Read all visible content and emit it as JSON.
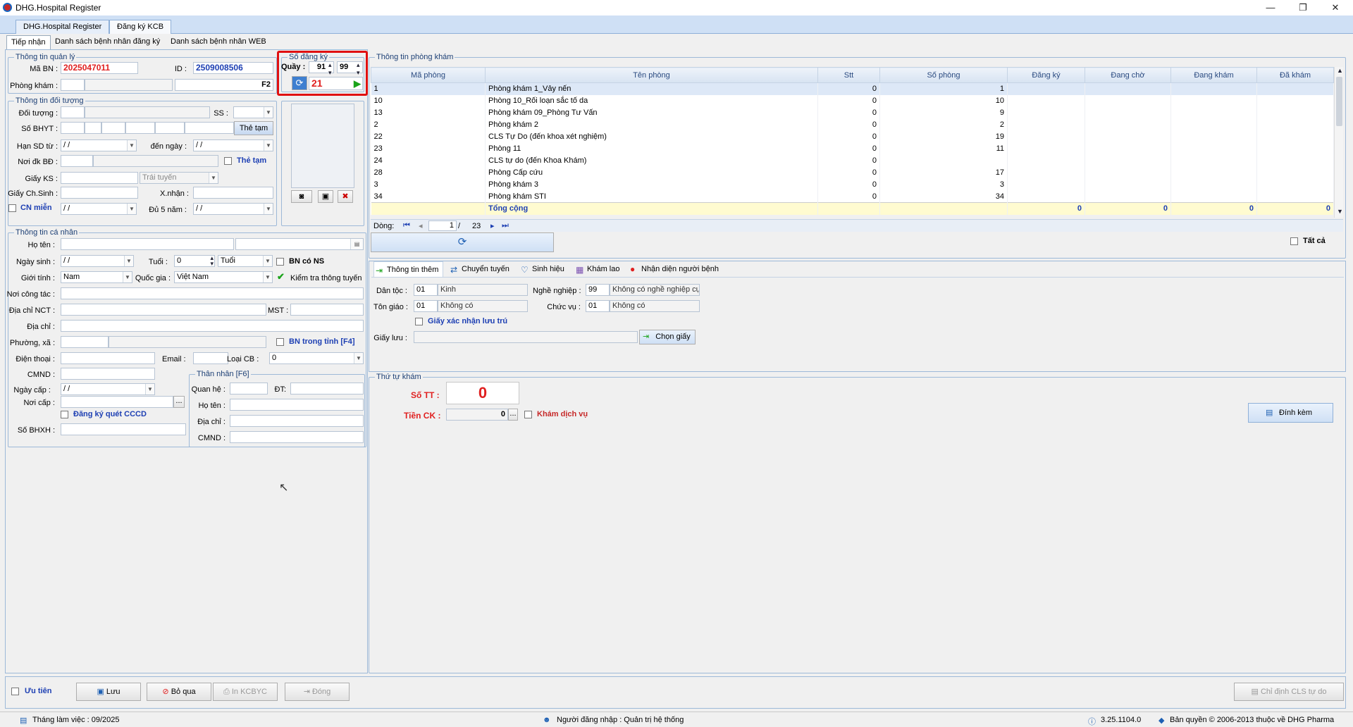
{
  "window": {
    "title": "DHG.Hospital Register",
    "controls": [
      "—",
      "❐",
      "✕"
    ]
  },
  "doc_tabs": [
    "DHG.Hospital Register",
    "Đăng ký KCB"
  ],
  "main_tabs": [
    "Tiếp nhận",
    "Danh sách bệnh nhân đăng ký",
    "Danh sách bệnh nhân WEB"
  ],
  "quanly": {
    "legend": "Thông tin quản lý",
    "mabn_label": "Mã BN :",
    "mabn": "2025047011",
    "id_label": "ID :",
    "id": "2509008506",
    "phongkham_label": "Phòng khám :",
    "f2": "F2"
  },
  "sodangky": {
    "legend": "Số đăng ký",
    "quay_label": "Quầy :",
    "quay1": "91",
    "quay2": "99",
    "so": "21"
  },
  "doituong": {
    "legend": "Thông tin đối tượng",
    "doituong_label": "Đối tượng :",
    "ss_label": "SS :",
    "sobhyt_label": "Số BHYT :",
    "thetam_btn": "Thẻ tạm",
    "hansd_label": "Hạn SD từ :",
    "denngay_label": "đến ngày :",
    "date_empty": " /    /",
    "noidk_label": "Nơi đk BĐ :",
    "thetam_chk": "Thẻ tạm",
    "giayks_label": "Giấy KS :",
    "traituyen": "Trái tuyến",
    "giaychsinh_label": "Giấy Ch.Sinh :",
    "xnhan_label": "X.nhận :",
    "cnmien_label": "CN miễn",
    "du5nam_label": "Đủ 5 năm :"
  },
  "canhan": {
    "legend": "Thông tin cá nhân",
    "hoten_label": "Họ tên :",
    "ngaysinh_label": "Ngày sinh :",
    "tuoi_label": "Tuổi :",
    "tuoi": "0",
    "tuoi_unit": "Tuổi",
    "bncons": "BN có NS",
    "gioitinh_label": "Giới tính :",
    "gioitinh": "Nam",
    "quocgia_label": "Quốc gia :",
    "quocgia": "Việt Nam",
    "kiemtra": "Kiểm tra thông tuyến",
    "noicongtac_label": "Nơi công tác :",
    "diachinct_label": "Địa chỉ NCT :",
    "mst_label": "MST :",
    "diachi_label": "Địa chỉ :",
    "phuongxa_label": "Phường, xã :",
    "bntrongtinh": "BN trong tỉnh [F4]",
    "dienthoai_label": "Điện thoại :",
    "email_label": "Email :",
    "loaicb_label": "Loại CB :",
    "loaicb": "0",
    "cmnd_label": "CMND :",
    "ngaycap_label": "Ngày cấp :",
    "noicap_label": "Nơi cấp :",
    "dots": "...",
    "dangkycccd": "Đăng ký quét CCCD",
    "sobhxh_label": "Số BHXH :",
    "thannhan": {
      "legend": "Thân nhân [F6]",
      "quanhe_label": "Quan hệ :",
      "dt_label": "ĐT:",
      "hoten_label": "Họ tên :",
      "diachi_label": "Địa chỉ :",
      "cmnd_label": "CMND :"
    }
  },
  "phongkham": {
    "legend": "Thông tin phòng khám",
    "columns": [
      "Mã phòng",
      "Tên phòng",
      "Stt",
      "Số phòng",
      "Đăng ký",
      "Đang chờ",
      "Đang khám",
      "Đã khám"
    ],
    "rows": [
      [
        "1",
        "Phòng khám 1_Vảy nến",
        "0",
        "1",
        "",
        "",
        "",
        ""
      ],
      [
        "10",
        "Phòng 10_Rối loạn sắc tố da",
        "0",
        "10",
        "",
        "",
        "",
        ""
      ],
      [
        "13",
        "Phòng khám 09_Phòng Tư Vấn",
        "0",
        "9",
        "",
        "",
        "",
        ""
      ],
      [
        "2",
        "Phòng khám 2",
        "0",
        "2",
        "",
        "",
        "",
        ""
      ],
      [
        "22",
        "CLS Tự Do (đến khoa xét nghiệm)",
        "0",
        "19",
        "",
        "",
        "",
        ""
      ],
      [
        "23",
        "Phòng 11",
        "0",
        "11",
        "",
        "",
        "",
        ""
      ],
      [
        "24",
        "CLS tự do (đến Khoa Khám)",
        "0",
        "",
        "",
        "",
        "",
        ""
      ],
      [
        "28",
        "Phòng Cấp cứu",
        "0",
        "17",
        "",
        "",
        "",
        ""
      ],
      [
        "3",
        "Phòng khám 3",
        "0",
        "3",
        "",
        "",
        "",
        ""
      ],
      [
        "34",
        "Phòng khám STI",
        "0",
        "34",
        "",
        "",
        "",
        ""
      ]
    ],
    "total": {
      "label": "Tổng cộng",
      "dangky": "0",
      "dangcho": "0",
      "dangkham": "0",
      "dakham": "0"
    },
    "nav": {
      "label": "Dòng:",
      "page": "1",
      "of": "/",
      "total": "23"
    },
    "tatca": "Tất cả"
  },
  "subtabs": [
    "Thông tin thêm",
    "Chuyển tuyến",
    "Sinh hiệu",
    "Khám lao",
    "Nhận diện người bệnh"
  ],
  "thongtinthem": {
    "dantoc_label": "Dân tộc :",
    "dantoc_code": "01",
    "dantoc": "Kinh",
    "nghenghiep_label": "Nghề nghiệp :",
    "nghenghiep_code": "99",
    "nghenghiep": "Không có nghề nghiệp cụ",
    "tongiao_label": "Tôn giáo :",
    "tongiao_code": "01",
    "tongiao": "Không có",
    "chucvu_label": "Chức vụ :",
    "chucvu_code": "01",
    "chucvu": "Không có",
    "giayxacnhan": "Giấy xác nhận lưu trú",
    "giayluu_label": "Giấy lưu :",
    "chongiay": "Chọn giấy"
  },
  "thutu": {
    "legend": "Thứ tự khám",
    "sott_label": "Số TT :",
    "sott": "0",
    "tienck_label": "Tiền CK :",
    "tienck": "0",
    "dots": "...",
    "khamdv": "Khám dịch vụ",
    "dinhkem": "Đính kèm"
  },
  "bottom": {
    "uutien": "Ưu tiên",
    "luu": "Lưu",
    "boqua": "Bỏ qua",
    "inkcbyc": "In KCBYC",
    "dong": "Đóng",
    "chidinh": "Chỉ định CLS tự do"
  },
  "status": {
    "thang": "Tháng làm việc : 09/2025",
    "nguoi": "Người đăng nhập : Quản trị hệ thống",
    "version": "3.25.1104.0",
    "banquyen": "Bản quyền © 2006-2013 thuộc về DHG Pharma"
  },
  "colors": {
    "accent_red": "#e02020",
    "accent_blue": "#1d3fb3",
    "highlight_border": "#e01010"
  }
}
